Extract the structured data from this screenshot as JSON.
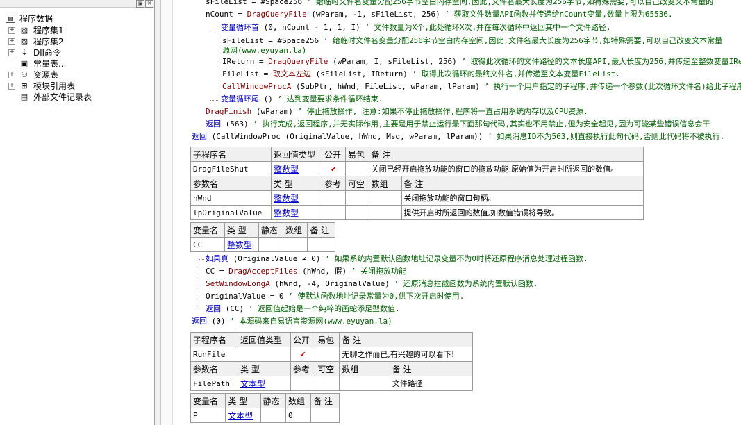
{
  "tree": {
    "root": "程序数据",
    "items": [
      {
        "label": "程序集1",
        "has_plus": true
      },
      {
        "label": "程序集2",
        "has_plus": true
      },
      {
        "label": "Dll命令",
        "has_plus": true
      },
      {
        "label": "常量表...",
        "has_plus": false
      },
      {
        "label": "资源表",
        "has_plus": true
      },
      {
        "label": "模块引用表",
        "has_plus": true
      },
      {
        "label": "外部文件记录表",
        "has_plus": false
      }
    ]
  },
  "code1": [
    {
      "a": "sFileList = #Space256",
      "c": "  ’ 给临时文件名变量分配256字节空白内存空间,因此,文件名最大长度为256字节,如特殊需要,可以自己改变文本常量的"
    },
    {
      "a": "nCount = ",
      "f": "DragQueryFile",
      "b": " (wParam, -1, sFileList, 256)",
      "c": "  ’ 获取文件数量API函数并传递给nCount变量,数量上限为65536."
    },
    {
      "k": "变量循环首",
      "b": " (0, nCount - 1, 1, I)",
      "c": "  ’ 文件数量为X个,此处循环X次,并在每次循环中返回其中一个文件路径."
    },
    {
      "a": "sFileList = #Space256",
      "c": "  ’ 给临时文件名变量分配256字节空白内存空间,因此,文件名最大长度为256字节,如特殊需要,可以自己改变文本常量"
    },
    {
      "c": "源网(www.eyuyan.la)"
    },
    {
      "a": "IReturn = ",
      "f": "DragQueryFile",
      "b": " (wParam, I, sFileList, 256)",
      "c": "  ’ 取得此次循环的文件路径的文本长度API,最大长度为256,并传递至整数变量IRe"
    },
    {
      "a": "FileList = ",
      "f": "取文本左边",
      "b": " (sFileList, IReturn)",
      "c": "  ’ 取得此次循环的最终文件名,并传递至文本变量FileList."
    },
    {
      "f": "CallWindowProcA",
      "b": " (SubPtr, hWnd, FileList, wParam, lParam)",
      "c": "  ’ 执行一个用户指定的子程序,并传递一个参数(此次循环文件名)给此子程序"
    },
    {
      "k": "变量循环尾",
      "b": " ()",
      "c": "  ’ 达到变量要求条件循环结束."
    },
    {
      "f": "DragFinish",
      "b": " (wParam)",
      "c": "  ’ 停止拖放操作, 注意:如果不停止拖放操作,程序将一直占用系统内存以及CPU资源."
    },
    {
      "k": "返回",
      "b": " (563)",
      "c": "  ’ 执行完成,返回程序,并无实际作用,主要是用于禁止运行最下面那句代码,其实也不用禁止,但为安全起见,因为可能某些错误信息会干"
    },
    {
      "k": "返回",
      "b": " (CallWindowProc (OriginalValue, hWnd, Msg, wParam, lParam))",
      "c": "  ’ 如果消息ID不为563,则直接执行此句代码,否则此代码将不被执行."
    }
  ],
  "sub1": {
    "headers": [
      "子程序名",
      "返回值类型",
      "公开",
      "易包",
      "备 注"
    ],
    "name": "DragFileShut",
    "ret": "整数型",
    "public": "✔",
    "remark": "关闭已经开启拖放功能的窗口的拖放功能,原始值为开启时所返回的数值。",
    "param_headers": [
      "参数名",
      "类 型",
      "参考",
      "可空",
      "数组",
      "备 注"
    ],
    "params": [
      {
        "name": "hWnd",
        "type": "整数型",
        "remark": "关闭拖放功能的窗口句柄。"
      },
      {
        "name": "lpOriginalValue",
        "type": "整数型",
        "remark": "提供开启时所返回的数值,如数值错误将导致。"
      }
    ]
  },
  "vars1": {
    "headers": [
      "变量名",
      "类 型",
      "静态",
      "数组",
      "备 注"
    ],
    "rows": [
      {
        "name": "CC",
        "type": "整数型"
      }
    ]
  },
  "code2": [
    {
      "k": "如果真",
      "b": " (OriginalValue ≠ 0)",
      "c": "  ’ 如果系统内置默认函数地址记录变量不为0时将还原程序消息处理过程函数."
    },
    {
      "a": "CC = ",
      "f": "DragAcceptFiles",
      "b": " (hWnd, 假)",
      "c": "  ’ 关闭拖放功能"
    },
    {
      "f": "SetWindowLongA",
      "b": " (hWnd, -4, OriginalValue)",
      "c": "  ’ 还原消息拦截函数为系统内置默认函数."
    },
    {
      "a": "OriginalValue = 0",
      "c": "  ’ 使默认函数地址记录常量为0,供下次开启时使用."
    },
    {
      "k": "返回",
      "b": " (CC)",
      "c": "  ’ 返回值起始是一个纯粹的画蛇添足型数值."
    },
    {
      "k": "返回",
      "b": " (0)",
      "c": "  ’ 本源码来自易语言资源网(www.eyuyan.la)"
    }
  ],
  "sub2": {
    "headers": [
      "子程序名",
      "返回值类型",
      "公开",
      "易包",
      "备 注"
    ],
    "name": "RunFile",
    "ret": "",
    "public": "✔",
    "remark": "无聊之作而已,有兴趣的可以看下!",
    "param_headers": [
      "参数名",
      "类 型",
      "参考",
      "可空",
      "数组",
      "备 注"
    ],
    "params": [
      {
        "name": "FilePath",
        "type": "文本型",
        "remark": "文件路径"
      }
    ]
  },
  "vars2": {
    "headers": [
      "变量名",
      "类 型",
      "静态",
      "数组",
      "备 注"
    ],
    "rows": [
      {
        "name": "P",
        "type": "文本型",
        "array": "0"
      }
    ]
  }
}
